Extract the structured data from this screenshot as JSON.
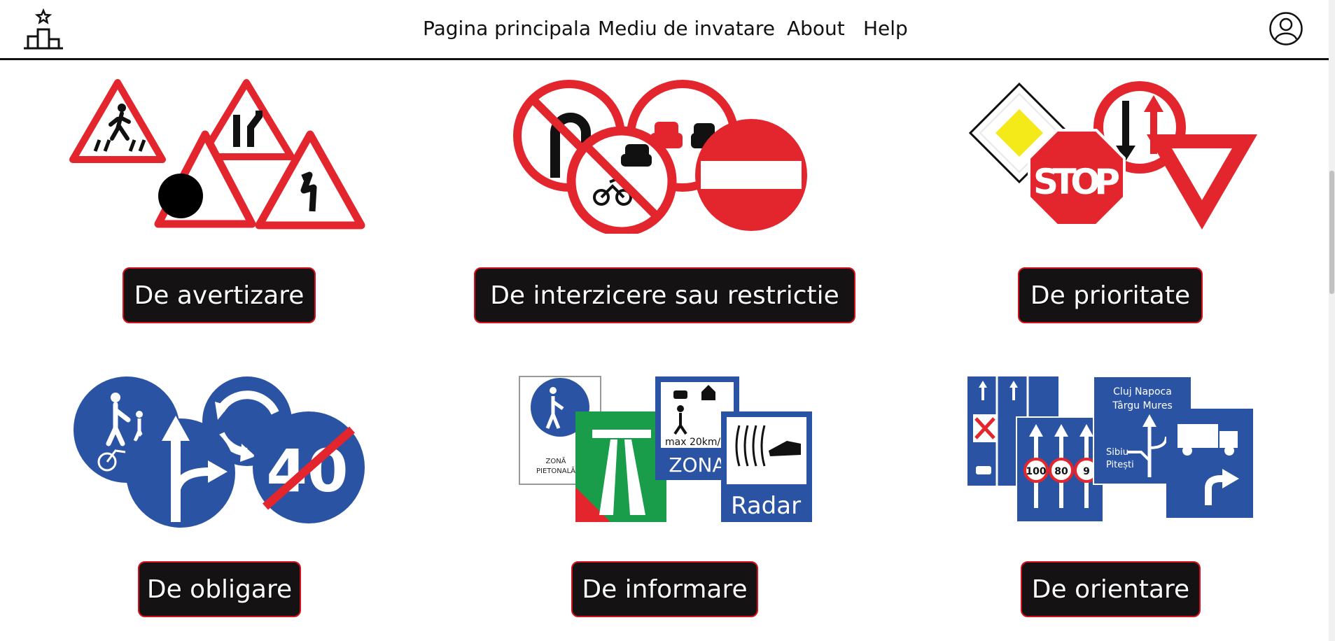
{
  "nav": {
    "items": [
      {
        "label": "Pagina principala"
      },
      {
        "label": "Mediu de invatare"
      },
      {
        "label": "About"
      },
      {
        "label": "Help"
      }
    ]
  },
  "cards": [
    {
      "label": "De avertizare",
      "icon": "warning-signs-icon"
    },
    {
      "label": "De interzicere sau restrictie",
      "icon": "prohibition-signs-icon"
    },
    {
      "label": "De prioritate",
      "icon": "priority-signs-icon"
    },
    {
      "label": "De obligare",
      "icon": "mandatory-signs-icon"
    },
    {
      "label": "De informare",
      "icon": "information-signs-icon"
    },
    {
      "label": "De orientare",
      "icon": "orientation-signs-icon"
    }
  ],
  "sign_text": {
    "stop": "STOP",
    "speed_limit": "40",
    "zone_label": "ZONĂ",
    "zone_pedestrian": "PIETONALĂ",
    "zona": "ZONA",
    "max_speed": "max 20km/h",
    "radar": "Radar",
    "city1": "Cluj Napoca",
    "city2": "Târgu Mureș",
    "city3": "Sibiu",
    "city4": "Pitești",
    "lane1": "100",
    "lane2": "80",
    "lane3": "9"
  },
  "colors": {
    "red": "#e3252d",
    "blue": "#2a54a3",
    "green": "#1a9d4a",
    "yellow": "#f4ea1a",
    "button_bg": "#141212",
    "button_border": "#d2121c"
  }
}
